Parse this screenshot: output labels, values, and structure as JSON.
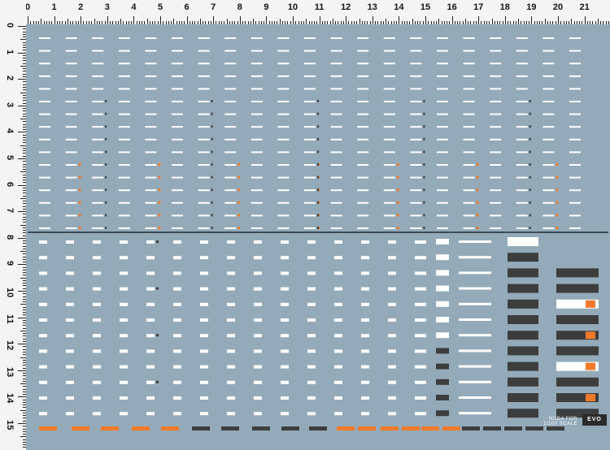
{
  "ruler": {
    "x_labels": [
      "0",
      "1",
      "2",
      "3",
      "4",
      "5",
      "6",
      "7",
      "8",
      "9",
      "10",
      "11",
      "12",
      "13",
      "14",
      "15",
      "16",
      "17",
      "18",
      "19",
      "20",
      "21"
    ],
    "y_labels": [
      "0",
      "1",
      "2",
      "3",
      "4",
      "5",
      "6",
      "7",
      "8",
      "9",
      "10",
      "11",
      "12",
      "13",
      "14",
      "15"
    ]
  },
  "colors": {
    "background": "#94aab9",
    "ruler": "#f4f4f4",
    "decal_white": "#ffffff",
    "decal_orange": "#f07a2a",
    "decal_dark": "#3d3d3d"
  },
  "branding": {
    "line1": "NCDA FOR",
    "line2": "1/100 SCALE",
    "logo": "EVO"
  }
}
